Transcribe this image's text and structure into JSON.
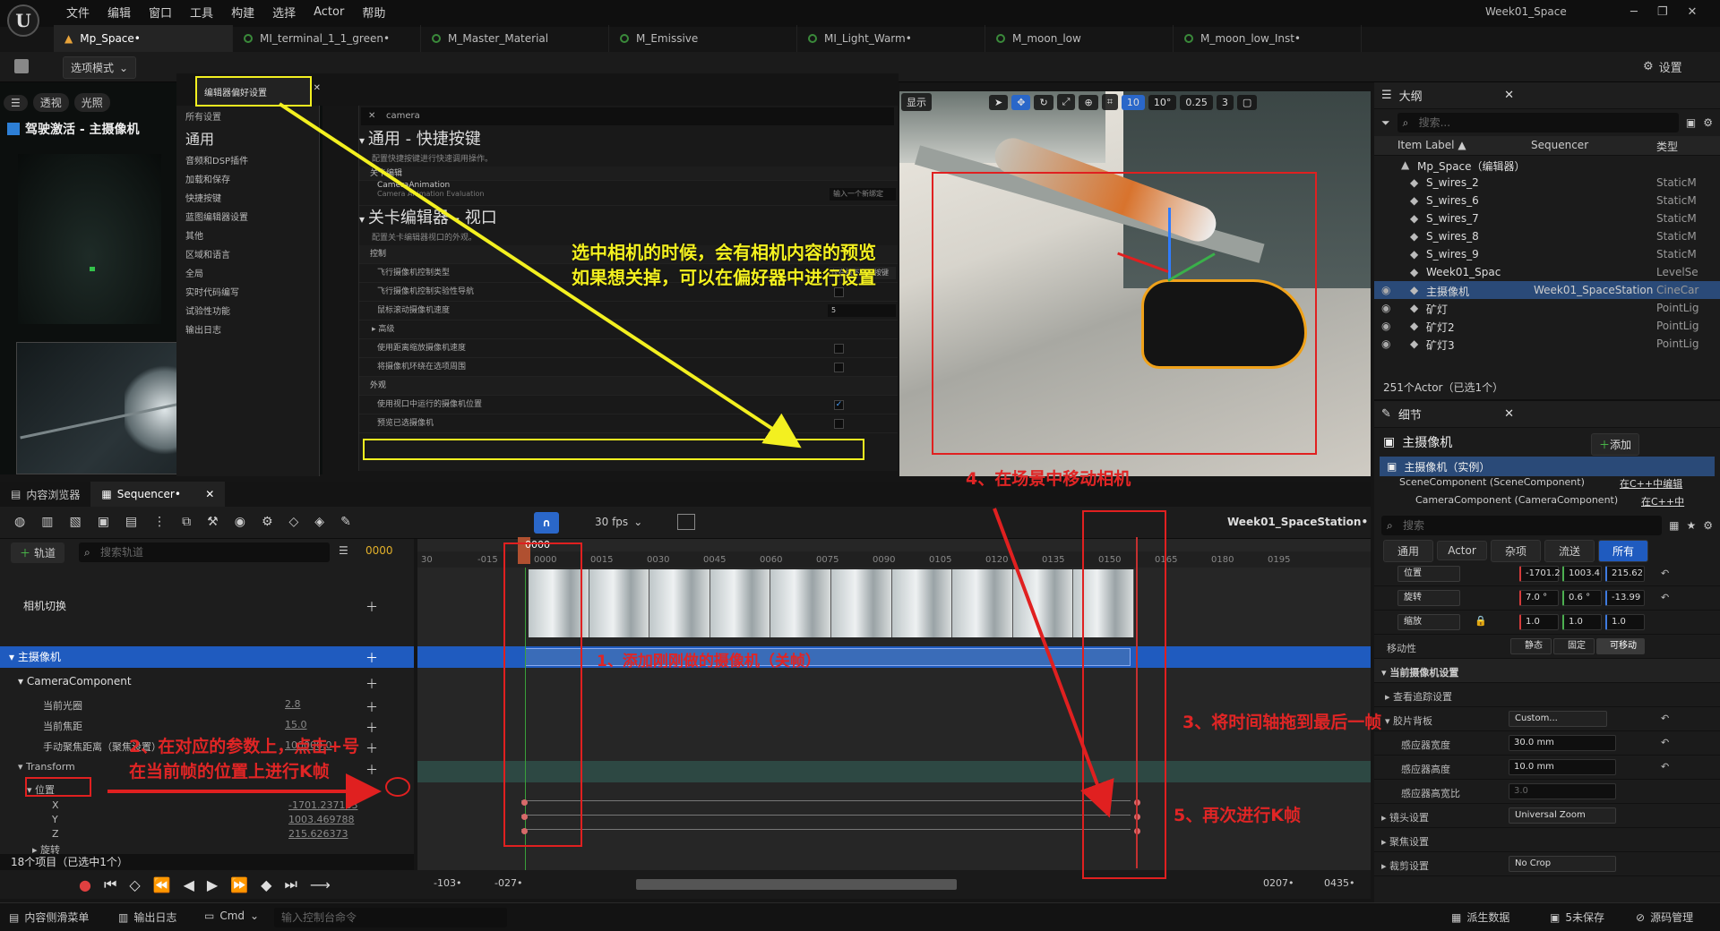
{
  "app": {
    "logo": "U",
    "project": "Week01_Space",
    "menu": [
      "文件",
      "编辑",
      "窗口",
      "工具",
      "构建",
      "选择",
      "Actor",
      "帮助"
    ],
    "window_controls": [
      "─",
      "❐",
      "✕"
    ]
  },
  "doc_tabs": [
    "Mp_Space•",
    "MI_terminal_1_1_green•",
    "M_Master_Material",
    "M_Emissive",
    "MI_Light_Warm•",
    "M_moon_low",
    "M_moon_low_Inst•"
  ],
  "toolbar": {
    "mode": "选项模式",
    "settings": "设置"
  },
  "viewport_left": {
    "buttons": [
      "透视",
      "光照"
    ],
    "pilot": "驾驶激活 - 主摄像机"
  },
  "prefs": {
    "tab": "编辑器偏好设置",
    "all_settings": "所有设置",
    "general": "通用",
    "categories": [
      "音频和DSP插件",
      "加载和保存",
      "快捷按键",
      "蓝图编辑器设置",
      "其他",
      "区域和语言",
      "全局",
      "实时代码编写",
      "试验性功能",
      "输出日志"
    ],
    "search": "camera",
    "s1_title": "通用 - 快捷按键",
    "s1_desc": "配置快捷按键进行快速调用操作。",
    "s1_cat": "关卡编辑",
    "s1_row1": "CameraAnimation",
    "s1_row1_sub": "Camera Animation Evaluation",
    "s1_input": "输入一个新绑定",
    "s2_title": "关卡编辑器 - 视口",
    "s2_desc": "配置关卡编辑器视口的外观。",
    "s2_cat1": "控制",
    "s2_rows": [
      "飞行摄像机控制类型",
      "飞行摄像机控制实验性导航",
      "鼠标滚动摄像机速度"
    ],
    "s2_sel": "仅在按下鼠标按键",
    "s2_speed": "5",
    "s2_adv": "高级",
    "s2_rows2": [
      "使用距离缩放摄像机速度",
      "将摄像机环绕在选项周围"
    ],
    "s2_cat2": "外观",
    "s2_rows3": [
      "使用视口中运行的摄像机位置",
      "预览已选摄像机"
    ]
  },
  "annotations": {
    "yellow": "选中相机的时候，会有相机内容的预览\n如果想关掉，可以在偏好器中进行设置",
    "a1": "1、添加刚刚做的摄像机（关帧）",
    "a2": "2、在对应的参数上，点击+号\n在当前帧的位置上进行K帧",
    "a3": "3、将时间轴拖到最后一帧",
    "a4": "4、在场景中移动相机",
    "a5": "5、再次进行K帧"
  },
  "viewport_right": {
    "show": "显示",
    "grid": "10",
    "angle": "10°",
    "scale": "0.25",
    "cam": "3"
  },
  "outliner": {
    "title": "大纲",
    "search": "搜索...",
    "col_label": "Item Label ▲",
    "col_seq": "Sequencer",
    "col_type": "类型",
    "rows": [
      {
        "label": "Mp_Space（编辑器）",
        "seq": "",
        "type": ""
      },
      {
        "label": "S_wires_2",
        "seq": "",
        "type": "StaticM"
      },
      {
        "label": "S_wires_6",
        "seq": "",
        "type": "StaticM"
      },
      {
        "label": "S_wires_7",
        "seq": "",
        "type": "StaticM"
      },
      {
        "label": "S_wires_8",
        "seq": "",
        "type": "StaticM"
      },
      {
        "label": "S_wires_9",
        "seq": "",
        "type": "StaticM"
      },
      {
        "label": "Week01_Spac",
        "seq": "",
        "type": "LevelSe"
      },
      {
        "label": "主摄像机",
        "seq": "Week01_SpaceStation",
        "type": "CineCar"
      },
      {
        "label": "矿灯",
        "seq": "",
        "type": "PointLig"
      },
      {
        "label": "矿灯2",
        "seq": "",
        "type": "PointLig"
      },
      {
        "label": "矿灯3",
        "seq": "",
        "type": "PointLig"
      }
    ],
    "count": "251个Actor（已选1个）"
  },
  "details": {
    "title": "细节",
    "actor": "主摄像机",
    "add": "添加",
    "instance": "主摄像机（实例）",
    "comp1": "SceneComponent (SceneComponent)",
    "comp1_link": "在C++中编辑",
    "comp2": "CameraComponent (CameraComponent)",
    "comp2_link": "在C++中",
    "search": "搜索",
    "filters": [
      "通用",
      "Actor",
      "杂项",
      "流送",
      "所有"
    ],
    "loc_label": "位置",
    "loc": [
      "-1701.2",
      "1003.4",
      "215.62"
    ],
    "rot_label": "旋转",
    "rot": [
      "7.0 °",
      "0.6 °",
      "-13.99"
    ],
    "scale_label": "缩放",
    "scale": [
      "1.0",
      "1.0",
      "1.0"
    ],
    "mob_label": "移动性",
    "mobility": [
      "静态",
      "固定",
      "可移动"
    ],
    "cam_settings": "当前摄像机设置",
    "lookat": "查看追踪设置",
    "filmback": "胶片背板",
    "filmback_val": "Custom...",
    "sensor_w": "感应器宽度",
    "sensor_w_val": "30.0 mm",
    "sensor_h": "感应器高度",
    "sensor_h_val": "10.0 mm",
    "aspect": "感应器高宽比",
    "aspect_val": "3.0",
    "lens": "镜头设置",
    "lens_val": "Universal Zoom",
    "focus": "聚焦设置",
    "crop": "裁剪设置",
    "crop_val": "No Crop"
  },
  "sequencer": {
    "tab_cb": "内容浏览器",
    "tab_seq": "Sequencer•",
    "fps": "30 fps",
    "seq_name": "Week01_SpaceStation•",
    "add_track": "轨道",
    "search": "搜索轨道",
    "frame": "0000",
    "camcut": "相机切换",
    "camera": "主摄像机",
    "cam_comp": "CameraComponent",
    "aperture": "当前光圈",
    "aperture_val": "2.8",
    "focal": "当前焦距",
    "focal_val": "15.0",
    "manual": "手动聚焦距离（聚焦设置）",
    "manual_val": "100000.0",
    "transform": "Transform",
    "location": "位置",
    "x": "X",
    "y": "Y",
    "z": "Z",
    "xv": "-1701.237183",
    "yv": "1003.469788",
    "zv": "215.626373",
    "rotation": "旋转",
    "items": "18个项目（已选中1个）",
    "ticks": [
      "30",
      "-015",
      "0000",
      "0015",
      "0030",
      "0045",
      "0060",
      "0075",
      "0090",
      "0105",
      "0120",
      "0135",
      "0150",
      "0165",
      "0180",
      "0195"
    ],
    "range_l": "-103•",
    "range_l2": "-027•",
    "range_r": "0207•",
    "range_r2": "0435•"
  },
  "status": {
    "drawer": "内容侧滑菜单",
    "log": "输出日志",
    "cmd": "Cmd",
    "cmd_ph": "输入控制台命令",
    "src": "派生数据",
    "unsaved": "5未保存",
    "scm": "源码管理"
  }
}
